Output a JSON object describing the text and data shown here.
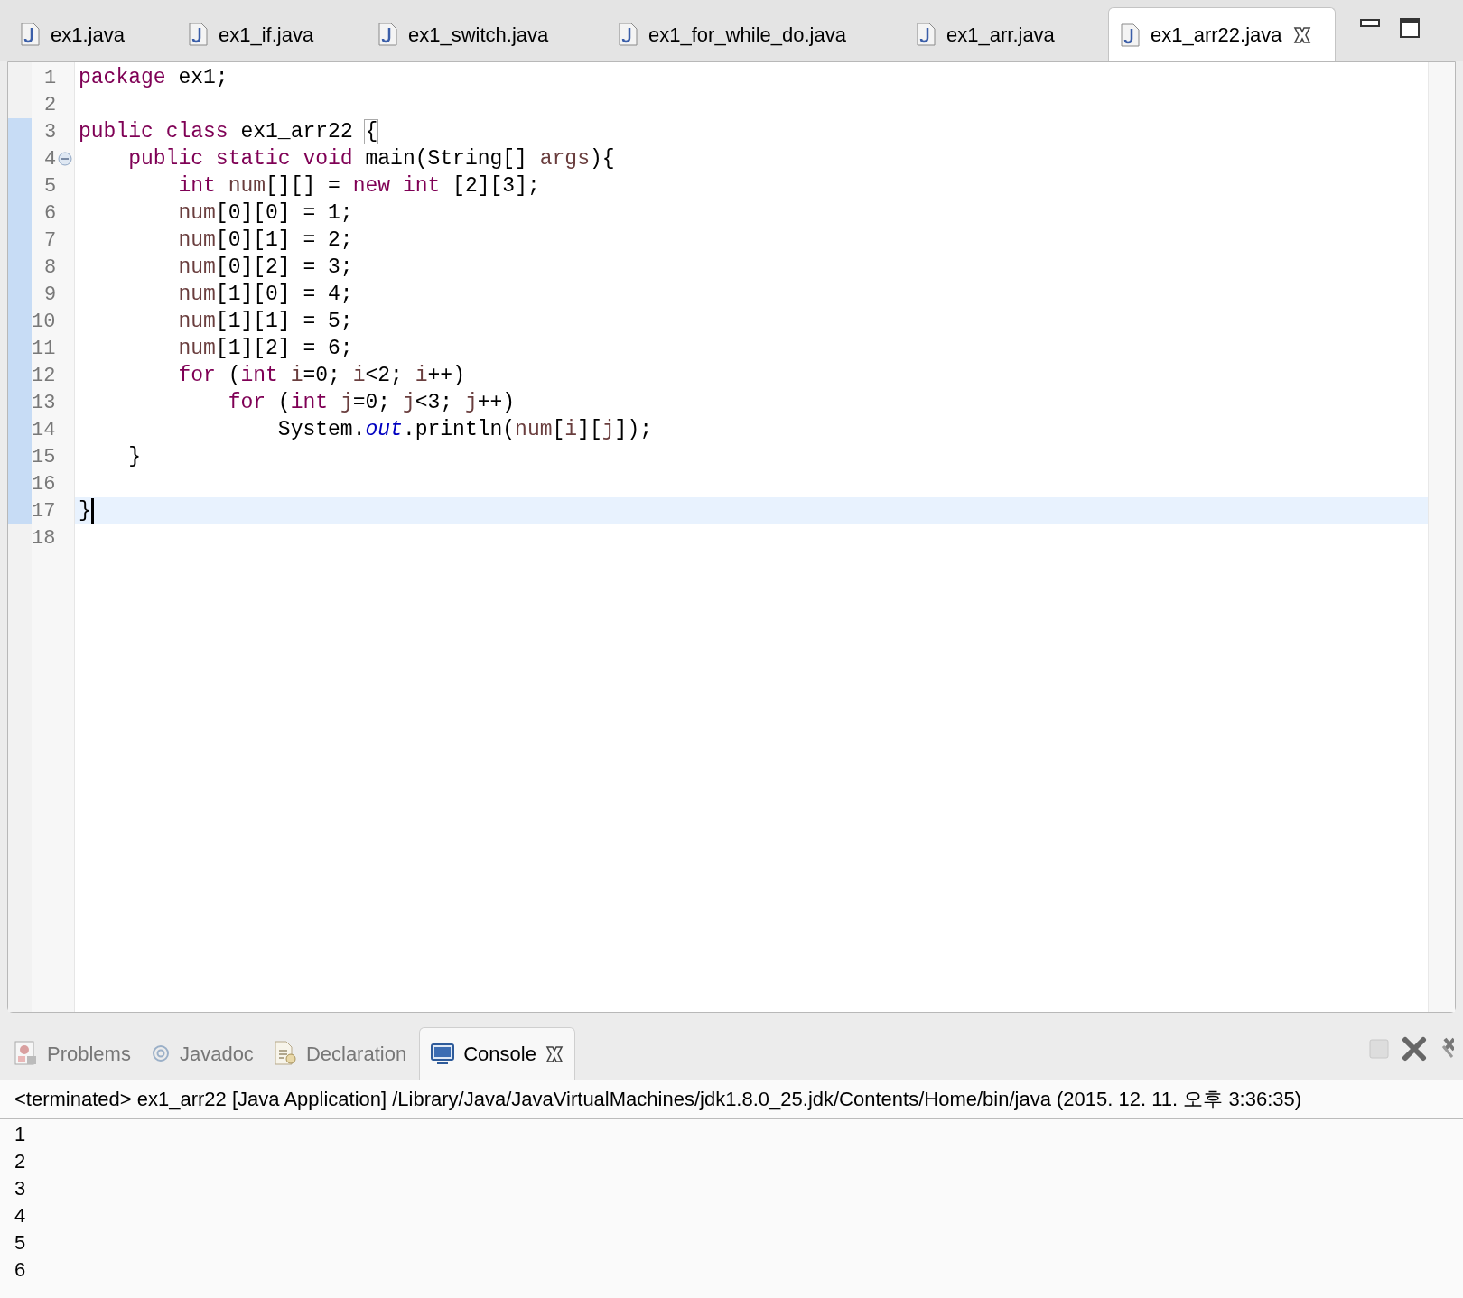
{
  "editor_tabs": [
    {
      "label": "ex1.java",
      "selected": false
    },
    {
      "label": "ex1_if.java",
      "selected": false
    },
    {
      "label": "ex1_switch.java",
      "selected": false
    },
    {
      "label": "ex1_for_while_do.java",
      "selected": false
    },
    {
      "label": "ex1_arr.java",
      "selected": false
    },
    {
      "label": "ex1_arr22.java",
      "selected": true
    }
  ],
  "code_lines": [
    {
      "number": "1",
      "changed": false,
      "current": false,
      "tokens": [
        {
          "kind": "keyword",
          "text": "package"
        },
        {
          "kind": "plain",
          "text": " ex1;"
        }
      ]
    },
    {
      "number": "2",
      "changed": false,
      "current": false
    },
    {
      "number": "3",
      "changed": true,
      "current": false,
      "tokens": [
        {
          "kind": "keyword",
          "text": "public"
        },
        {
          "kind": "keyword",
          "text": " class"
        },
        {
          "kind": "plain",
          "text": " ex1_arr22 "
        },
        {
          "kind": "bracket",
          "text": "{"
        }
      ]
    },
    {
      "number": "4",
      "changed": true,
      "current": false,
      "folded": false,
      "tokens": [
        {
          "kind": "keyword",
          "text": "    public"
        },
        {
          "kind": "keyword",
          "text": " static"
        },
        {
          "kind": "keyword",
          "text": " void"
        },
        {
          "kind": "plain",
          "text": " main(String[] "
        },
        {
          "kind": "variable",
          "text": "args"
        },
        {
          "kind": "plain",
          "text": "){"
        }
      ]
    },
    {
      "number": "5",
      "changed": true,
      "current": false,
      "tokens": [
        {
          "kind": "keyword",
          "text": "        int"
        },
        {
          "kind": "variable",
          "text": " num"
        },
        {
          "kind": "plain",
          "text": "[][] = "
        },
        {
          "kind": "keyword",
          "text": "new"
        },
        {
          "kind": "keyword",
          "text": " int"
        },
        {
          "kind": "plain",
          "text": " [2][3];"
        }
      ]
    },
    {
      "number": "6",
      "changed": true,
      "current": false,
      "tokens": [
        {
          "kind": "variable",
          "text": "        num"
        },
        {
          "kind": "plain",
          "text": "[0][0] = 1;"
        }
      ]
    },
    {
      "number": "7",
      "changed": true,
      "current": false,
      "tokens": [
        {
          "kind": "variable",
          "text": "        num"
        },
        {
          "kind": "plain",
          "text": "[0][1] = 2;"
        }
      ]
    },
    {
      "number": "8",
      "changed": true,
      "current": false,
      "tokens": [
        {
          "kind": "variable",
          "text": "        num"
        },
        {
          "kind": "plain",
          "text": "[0][2] = 3;"
        }
      ]
    },
    {
      "number": "9",
      "changed": true,
      "current": false,
      "tokens": [
        {
          "kind": "variable",
          "text": "        num"
        },
        {
          "kind": "plain",
          "text": "[1][0] = 4;"
        }
      ]
    },
    {
      "number": "10",
      "changed": true,
      "current": false,
      "tokens": [
        {
          "kind": "variable",
          "text": "        num"
        },
        {
          "kind": "plain",
          "text": "[1][1] = 5;"
        }
      ]
    },
    {
      "number": "11",
      "changed": true,
      "current": false,
      "tokens": [
        {
          "kind": "variable",
          "text": "        num"
        },
        {
          "kind": "plain",
          "text": "[1][2] = 6;"
        }
      ]
    },
    {
      "number": "12",
      "changed": true,
      "current": false,
      "tokens": [
        {
          "kind": "keyword",
          "text": "        for"
        },
        {
          "kind": "plain",
          "text": " ("
        },
        {
          "kind": "keyword",
          "text": "int"
        },
        {
          "kind": "variable",
          "text": " i"
        },
        {
          "kind": "plain",
          "text": "=0; "
        },
        {
          "kind": "variable",
          "text": "i"
        },
        {
          "kind": "plain",
          "text": "<2; "
        },
        {
          "kind": "variable",
          "text": "i"
        },
        {
          "kind": "plain",
          "text": "++)"
        }
      ]
    },
    {
      "number": "13",
      "changed": true,
      "current": false,
      "tokens": [
        {
          "kind": "keyword",
          "text": "            for"
        },
        {
          "kind": "plain",
          "text": " ("
        },
        {
          "kind": "keyword",
          "text": "int"
        },
        {
          "kind": "variable",
          "text": " j"
        },
        {
          "kind": "plain",
          "text": "=0; "
        },
        {
          "kind": "variable",
          "text": "j"
        },
        {
          "kind": "plain",
          "text": "<3; "
        },
        {
          "kind": "variable",
          "text": "j"
        },
        {
          "kind": "plain",
          "text": "++)"
        }
      ]
    },
    {
      "number": "14",
      "changed": true,
      "current": false,
      "tokens": [
        {
          "kind": "plain",
          "text": "                System."
        },
        {
          "kind": "field",
          "text": "out"
        },
        {
          "kind": "plain",
          "text": ".println("
        },
        {
          "kind": "variable",
          "text": "num"
        },
        {
          "kind": "plain",
          "text": "["
        },
        {
          "kind": "variable",
          "text": "i"
        },
        {
          "kind": "plain",
          "text": "]["
        },
        {
          "kind": "variable",
          "text": "j"
        },
        {
          "kind": "plain",
          "text": "]);"
        }
      ]
    },
    {
      "number": "15",
      "changed": true,
      "current": false,
      "tokens": [
        {
          "kind": "plain",
          "text": "    }"
        }
      ]
    },
    {
      "number": "16",
      "changed": true,
      "current": false
    },
    {
      "number": "17",
      "changed": true,
      "current": true,
      "caret": true,
      "tokens": [
        {
          "kind": "plain",
          "text": "}"
        }
      ]
    },
    {
      "number": "18",
      "changed": false,
      "current": false
    }
  ],
  "panel_tabs": [
    {
      "label": "Problems",
      "kind": "problems",
      "selected": false
    },
    {
      "label": "Javadoc",
      "kind": "javadoc",
      "selected": false
    },
    {
      "label": "Declaration",
      "kind": "declaration",
      "selected": false
    },
    {
      "label": "Console",
      "kind": "console",
      "selected": true
    }
  ],
  "console": {
    "header": "<terminated> ex1_arr22 [Java Application] /Library/Java/JavaVirtualMachines/jdk1.8.0_25.jdk/Contents/Home/bin/java (2015. 12. 11. 오후 3:36:35)",
    "output": [
      "1",
      "2",
      "3",
      "4",
      "5",
      "6"
    ]
  }
}
